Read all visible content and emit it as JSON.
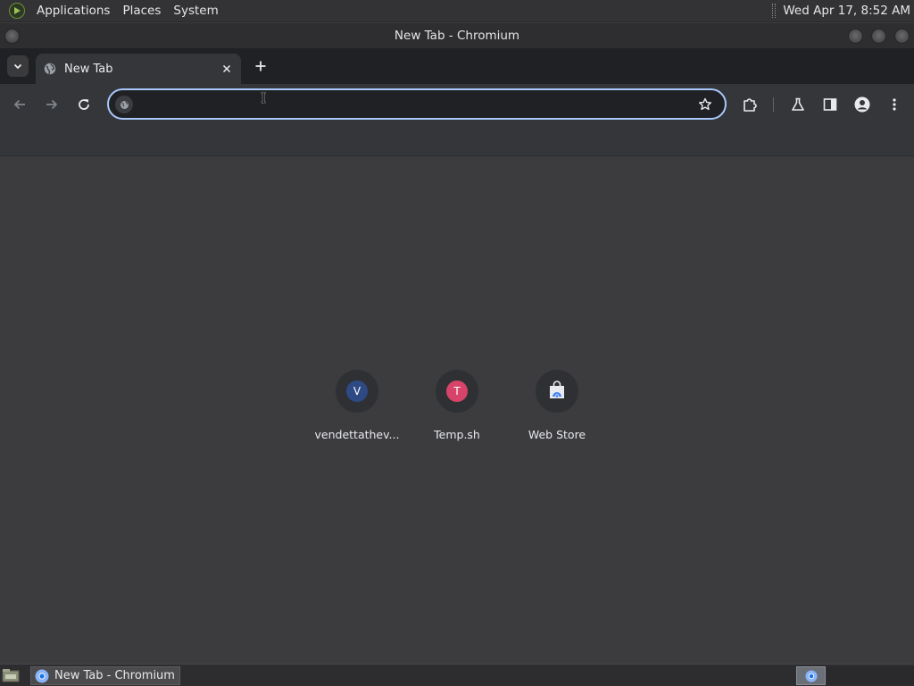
{
  "top_panel": {
    "menu": [
      "Applications",
      "Places",
      "System"
    ],
    "clock": "Wed Apr 17,  8:52 AM"
  },
  "window": {
    "title": "New Tab - Chromium"
  },
  "tabs": [
    {
      "title": "New Tab",
      "active": true
    }
  ],
  "toolbar": {
    "omnibox_value": "",
    "icons": [
      "back-icon",
      "forward-icon",
      "reload-icon",
      "bookmark-star-icon",
      "extensions-icon",
      "labs-flask-icon",
      "side-panel-icon",
      "profile-icon",
      "more-menu-icon"
    ]
  },
  "shortcuts": [
    {
      "letter": "V",
      "label": "vendettathev...",
      "color": "#2e4a85"
    },
    {
      "letter": "T",
      "label": "Temp.sh",
      "color": "#d64569"
    },
    {
      "letter": "",
      "label": "Web Store",
      "color": "#e8eaed"
    }
  ],
  "taskbar": {
    "task_label": "New Tab - Chromium"
  },
  "colors": {
    "accent": "#a8c7fa",
    "background": "#3c3c3f",
    "toolbar": "#35363a",
    "tabstrip": "#202124"
  }
}
